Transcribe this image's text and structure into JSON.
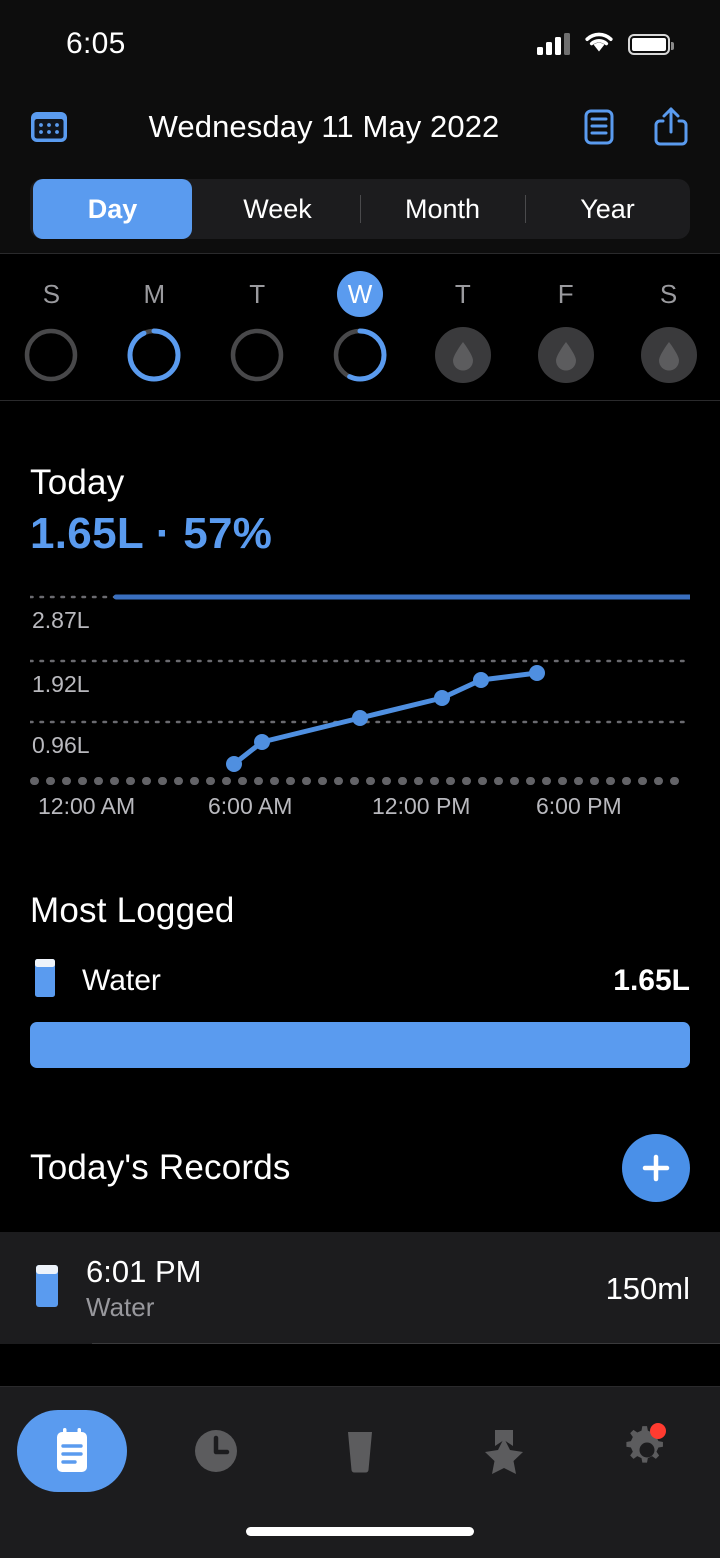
{
  "status_bar": {
    "time": "6:05",
    "cellular_icon": "cellular-signal-icon",
    "wifi_icon": "wifi-icon",
    "battery_icon": "battery-icon"
  },
  "navbar": {
    "title": "Wednesday 11 May 2022",
    "calendar_icon": "calendar-icon",
    "list_icon": "list-icon",
    "share_icon": "share-icon"
  },
  "segmented": {
    "items": [
      {
        "label": "Day",
        "active": true
      },
      {
        "label": "Week",
        "active": false
      },
      {
        "label": "Month",
        "active": false
      },
      {
        "label": "Year",
        "active": false
      }
    ]
  },
  "week_strip": {
    "days": [
      {
        "letter": "S",
        "today": false,
        "state": "empty",
        "progress": 0
      },
      {
        "letter": "M",
        "today": false,
        "state": "ring",
        "progress": 93
      },
      {
        "letter": "T",
        "today": false,
        "state": "empty",
        "progress": 0
      },
      {
        "letter": "W",
        "today": true,
        "state": "ring",
        "progress": 57
      },
      {
        "letter": "T",
        "today": false,
        "state": "future",
        "progress": 0
      },
      {
        "letter": "F",
        "today": false,
        "state": "future",
        "progress": 0
      },
      {
        "letter": "S",
        "today": false,
        "state": "future",
        "progress": 0
      }
    ]
  },
  "today": {
    "title": "Today",
    "value": "1.65L · 57%",
    "amount": "1.65L",
    "percent": "57%"
  },
  "chart_data": {
    "type": "line",
    "title": "Today",
    "xlabel": "",
    "ylabel": "",
    "grid": true,
    "legend": false,
    "ylim": [
      0,
      2.87
    ],
    "y_ticks": [
      0.96,
      1.92,
      2.87
    ],
    "y_tick_labels": [
      "0.96L",
      "1.92L",
      "2.87L"
    ],
    "goal_line": 2.87,
    "goal_line_label": "2.87L",
    "x_tick_labels": [
      "12:00 AM",
      "6:00 AM",
      "12:00 PM",
      "6:00 PM"
    ],
    "x_ticks_hours": [
      0,
      6,
      12,
      18
    ],
    "xlim_hours": [
      0,
      24
    ],
    "series": [
      {
        "name": "Cumulative water",
        "x_hours": [
          7.2,
          8.5,
          11.0,
          14.2,
          16.0,
          17.9
        ],
        "values": [
          0.45,
          0.65,
          0.95,
          1.2,
          1.45,
          1.65
        ],
        "unit": "L"
      }
    ]
  },
  "most_logged": {
    "title": "Most Logged",
    "drink_icon": "water-glass-icon",
    "name": "Water",
    "value": "1.65L",
    "bar_fill_percent": 100
  },
  "records": {
    "title": "Today's Records",
    "add_icon": "plus-icon",
    "items": [
      {
        "icon": "water-glass-icon",
        "time": "6:01 PM",
        "type": "Water",
        "amount": "150ml"
      }
    ]
  },
  "tabbar": {
    "tabs": [
      {
        "name": "log",
        "icon": "clipboard-icon",
        "active": true,
        "badge": false
      },
      {
        "name": "history",
        "icon": "clock-icon",
        "active": false,
        "badge": false
      },
      {
        "name": "drinks",
        "icon": "cup-icon",
        "active": false,
        "badge": false
      },
      {
        "name": "achievements",
        "icon": "star-badge-icon",
        "active": false,
        "badge": false
      },
      {
        "name": "settings",
        "icon": "gear-icon",
        "active": false,
        "badge": true
      }
    ]
  },
  "colors": {
    "accent": "#5a9bef",
    "accent_dark": "#3a6fbf",
    "background": "#000000",
    "surface": "#1c1c1e",
    "text_primary": "#ffffff",
    "text_secondary": "#98989d",
    "badge": "#ff3b30"
  }
}
